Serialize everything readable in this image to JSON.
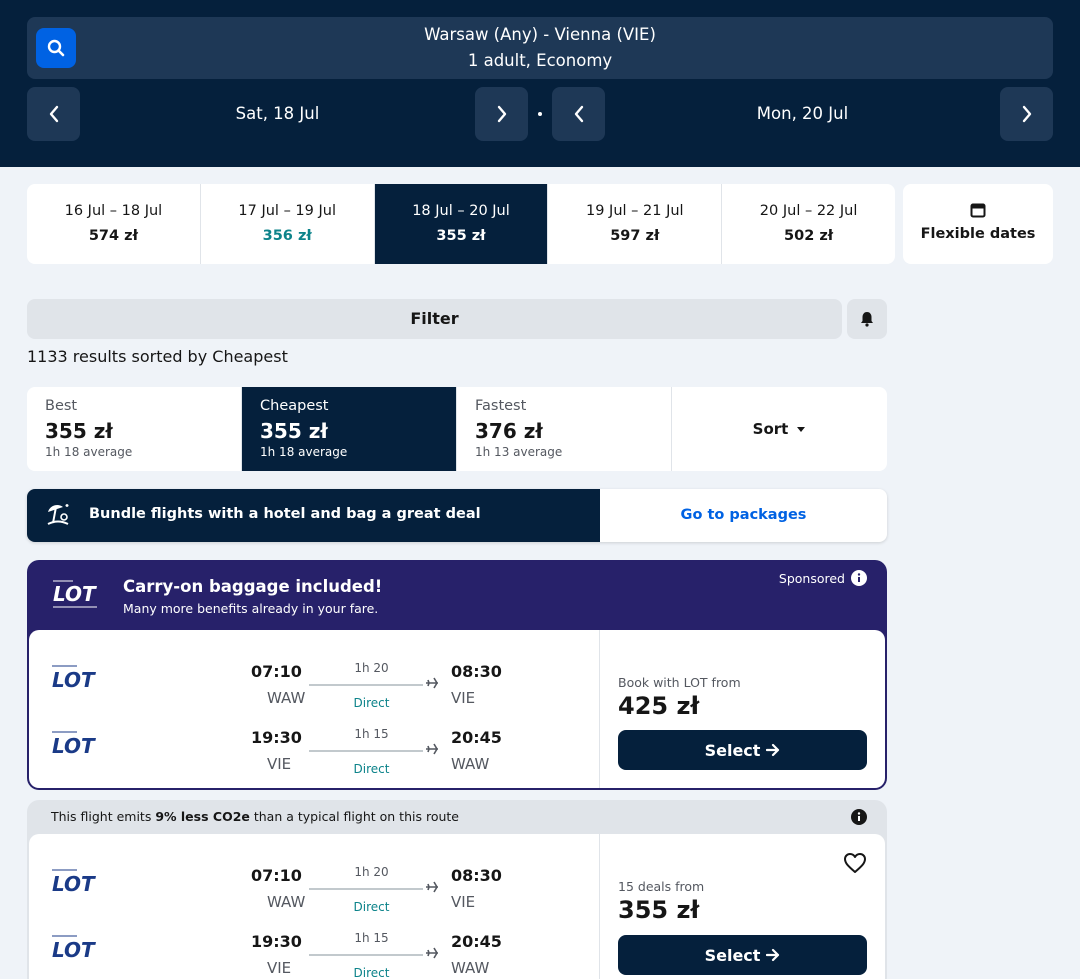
{
  "search": {
    "route": "Warsaw (Any) - Vienna (VIE)",
    "passengers": "1 adult, Economy",
    "depart_date": "Sat, 18 Jul",
    "return_date": "Mon, 20 Jul"
  },
  "date_options": [
    {
      "range": "16 Jul – 18 Jul",
      "price": "574 zł",
      "selected": false,
      "cheapest": false
    },
    {
      "range": "17 Jul – 19 Jul",
      "price": "356 zł",
      "selected": false,
      "cheapest": true
    },
    {
      "range": "18 Jul – 20 Jul",
      "price": "355 zł",
      "selected": true,
      "cheapest": false
    },
    {
      "range": "19 Jul – 21 Jul",
      "price": "597 zł",
      "selected": false,
      "cheapest": false
    },
    {
      "range": "20 Jul – 22 Jul",
      "price": "502 zł",
      "selected": false,
      "cheapest": false
    }
  ],
  "flexible_dates_label": "Flexible dates",
  "filter_label": "Filter",
  "results_text": "1133 results sorted by Cheapest",
  "sort_tabs": [
    {
      "title": "Best",
      "price": "355 zł",
      "avg": "1h 18 average"
    },
    {
      "title": "Cheapest",
      "price": "355 zł",
      "avg": "1h 18 average"
    },
    {
      "title": "Fastest",
      "price": "376 zł",
      "avg": "1h 13 average"
    }
  ],
  "sort_label": "Sort",
  "bundle": {
    "message": "Bundle flights with a hotel and bag a great deal",
    "action": "Go to packages"
  },
  "sponsored": {
    "title": "Carry-on baggage included!",
    "subtitle": "Many more benefits already in your fare.",
    "tag": "Sponsored",
    "book_from": "Book with LOT from",
    "price": "425 zł",
    "select_label": "Select"
  },
  "co2_notice": {
    "prefix": "This flight emits ",
    "bold": "9% less CO2e",
    "suffix": " than a typical flight on this route"
  },
  "itinerary_1": {
    "outbound": {
      "dep_time": "07:10",
      "dep_code": "WAW",
      "duration": "1h 20",
      "stops": "Direct",
      "arr_time": "08:30",
      "arr_code": "VIE"
    },
    "inbound": {
      "dep_time": "19:30",
      "dep_code": "VIE",
      "duration": "1h 15",
      "stops": "Direct",
      "arr_time": "20:45",
      "arr_code": "WAW"
    }
  },
  "itinerary_2": {
    "outbound": {
      "dep_time": "07:10",
      "dep_code": "WAW",
      "duration": "1h 20",
      "stops": "Direct",
      "arr_time": "08:30",
      "arr_code": "VIE"
    },
    "inbound": {
      "dep_time": "19:30",
      "dep_code": "VIE",
      "duration": "1h 15",
      "stops": "Direct",
      "arr_time": "20:45",
      "arr_code": "WAW"
    },
    "deals_from": "15 deals from",
    "price": "355 zł",
    "select_label": "Select"
  },
  "colors": {
    "header_bg": "#05203c",
    "accent_blue": "#0062e3",
    "cheap_teal": "#0c838a",
    "sponsored_bg": "#27216a"
  },
  "icons": [
    "search-icon",
    "chevron-left-icon",
    "chevron-right-icon",
    "calendar-icon",
    "bell-icon",
    "chevron-down-icon",
    "beach-umbrella-icon",
    "info-icon",
    "plane-icon",
    "arrow-right-icon",
    "heart-icon"
  ]
}
